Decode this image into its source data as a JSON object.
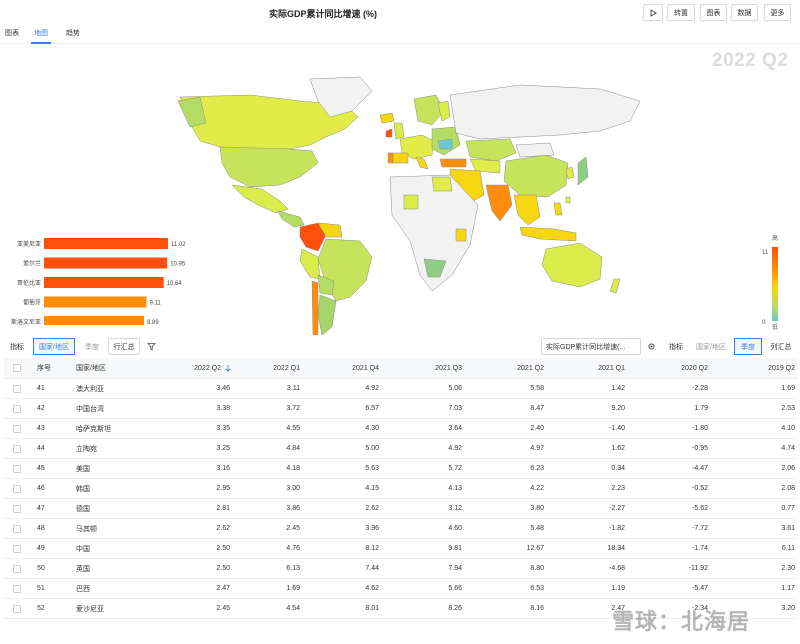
{
  "header": {
    "title": "实际GDP累计同比增速 (%)",
    "play_icon": "play-icon",
    "buttons": {
      "rotate": "转置",
      "chart": "图表",
      "data": "数据",
      "more": "更多"
    }
  },
  "tabs": [
    {
      "label": "图表"
    },
    {
      "label": "地图"
    },
    {
      "label": "趋势"
    }
  ],
  "active_tab": "地图",
  "map": {
    "period_label": "2022 Q2",
    "legend": {
      "high_label": "高",
      "low_label": "低",
      "max": "11",
      "min": "0"
    },
    "colors": {
      "highest": "#ff4f0a",
      "high": "#ff8c0a",
      "mid": "#f5d60f",
      "midlow": "#d9ec4a",
      "low": "#b5dc62",
      "lower": "#8fcf84",
      "lowest": "#6cc7d6",
      "nodata": "#f2f2f2",
      "border": "#8a8a8a"
    }
  },
  "chart_data": {
    "type": "bar",
    "title": "",
    "categories": [
      "亚美尼亚",
      "爱尔兰",
      "哥伦比亚",
      "葡萄牙",
      "斯洛文尼亚"
    ],
    "values": [
      11.02,
      10.95,
      10.64,
      9.11,
      8.89
    ],
    "value_labels": [
      "11.02",
      "10.95",
      "10.64",
      "9.11",
      "8.89"
    ],
    "xlim": [
      0,
      11.02
    ],
    "colors": [
      "#ff4f0a",
      "#ff4f0a",
      "#ff4f0a",
      "#ff8c0a",
      "#ff8c0a"
    ]
  },
  "toolbar": {
    "left": {
      "indicator": "指标",
      "country": "国家/地区",
      "quarter": "季度",
      "row_summary": "行汇总",
      "filter_icon": "filter-icon"
    },
    "right": {
      "select_value": "实际GDP累计同比增速(...",
      "settings_icon": "gear-icon",
      "indicator": "指标",
      "country": "国家/地区",
      "quarter": "季度",
      "col_summary": "列汇总"
    }
  },
  "table": {
    "columns": [
      "序号",
      "国家/地区",
      "2022 Q2",
      "2022 Q1",
      "2021 Q4",
      "2021 Q3",
      "2021 Q2",
      "2021 Q1",
      "2020 Q2",
      "2019 Q2"
    ],
    "sort_icon": "arrow-down-icon",
    "rows": [
      [
        "41",
        "澳大利亚",
        "3.46",
        "3.11",
        "4.92",
        "5.06",
        "5.58",
        "1.42",
        "-2.28",
        "1.69"
      ],
      [
        "42",
        "中国台湾",
        "3.38",
        "3.72",
        "6.57",
        "7.03",
        "8.47",
        "9.20",
        "1.79",
        "2.53"
      ],
      [
        "43",
        "哈萨克斯坦",
        "3.35",
        "4.55",
        "4.30",
        "3.64",
        "2.40",
        "-1.40",
        "-1.80",
        "4.10"
      ],
      [
        "44",
        "立陶宛",
        "3.25",
        "4.84",
        "5.00",
        "4.92",
        "4.97",
        "1.62",
        "-0.95",
        "4.74"
      ],
      [
        "45",
        "美国",
        "3.16",
        "4.18",
        "5.63",
        "5.72",
        "6.23",
        "0.34",
        "-4.47",
        "2.06"
      ],
      [
        "46",
        "韩国",
        "2.95",
        "3.00",
        "4.15",
        "4.13",
        "4.22",
        "2.23",
        "-0.52",
        "2.08"
      ],
      [
        "47",
        "德国",
        "2.81",
        "3.86",
        "2.62",
        "3.12",
        "3.80",
        "-2.27",
        "-5.62",
        "0.77"
      ],
      [
        "48",
        "马其顿",
        "2.62",
        "2.45",
        "3.96",
        "4.60",
        "5.48",
        "-1.82",
        "-7.72",
        "3.61"
      ],
      [
        "49",
        "中国",
        "2.50",
        "4.76",
        "8.12",
        "9.81",
        "12.67",
        "18.34",
        "-1.74",
        "6.11"
      ],
      [
        "50",
        "英国",
        "2.50",
        "6.13",
        "7.44",
        "7.94",
        "8.80",
        "-4.68",
        "-11.92",
        "2.30"
      ],
      [
        "51",
        "巴西",
        "2.47",
        "1.69",
        "4.62",
        "5.66",
        "6.53",
        "1.19",
        "-5.47",
        "1.17"
      ],
      [
        "52",
        "爱沙尼亚",
        "2.45",
        "4.54",
        "8.01",
        "8.26",
        "8.16",
        "2.47",
        "-2.34",
        "3.20"
      ]
    ]
  },
  "watermark": "雪球：北海居"
}
